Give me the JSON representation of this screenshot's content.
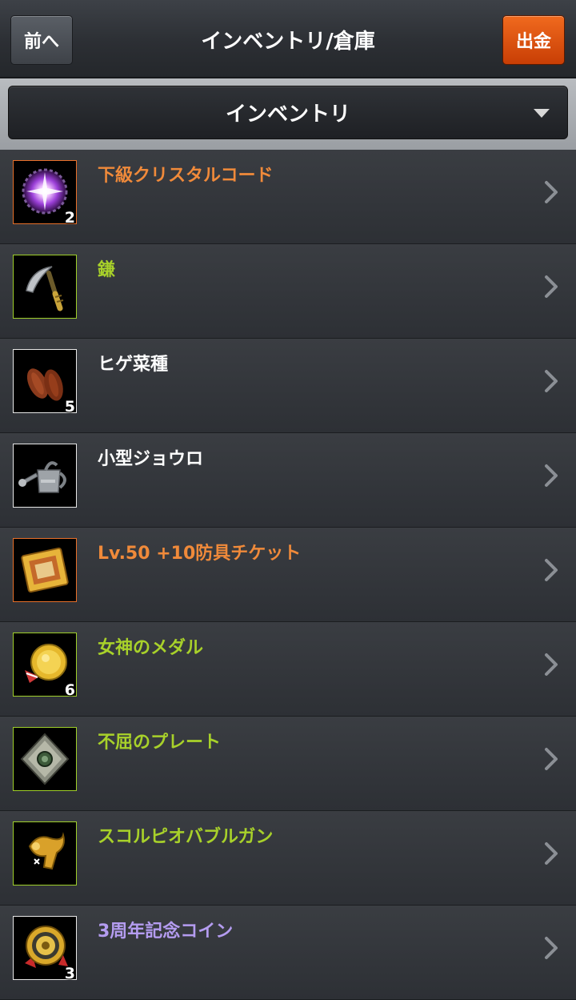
{
  "header": {
    "back_label": "前へ",
    "title": "インベントリ/倉庫",
    "withdraw_label": "出金"
  },
  "selector": {
    "selected": "インベントリ"
  },
  "colors": {
    "orange": "#f08a3a",
    "green": "#a8d12a",
    "white": "#ffffff",
    "purple": "#b49cf0"
  },
  "items": [
    {
      "name": "下級クリスタルコード",
      "qty": "2",
      "grade": "orange",
      "icon": "crystal-icon"
    },
    {
      "name": "鎌",
      "qty": "",
      "grade": "green",
      "icon": "sickle-icon"
    },
    {
      "name": "ヒゲ菜種",
      "qty": "5",
      "grade": "white",
      "icon": "seeds-icon"
    },
    {
      "name": "小型ジョウロ",
      "qty": "",
      "grade": "white",
      "icon": "watering-can-icon"
    },
    {
      "name": "Lv.50 +10防具チケット",
      "qty": "",
      "grade": "orange",
      "icon": "ticket-icon"
    },
    {
      "name": "女神のメダル",
      "qty": "6",
      "grade": "green",
      "icon": "medal-icon"
    },
    {
      "name": "不屈のプレート",
      "qty": "",
      "grade": "green",
      "icon": "plate-icon"
    },
    {
      "name": "スコルピオバブルガン",
      "qty": "",
      "grade": "green",
      "icon": "bubble-gun-icon"
    },
    {
      "name": "3周年記念コイン",
      "qty": "3",
      "grade": "purple",
      "icon": "coin-icon"
    }
  ]
}
